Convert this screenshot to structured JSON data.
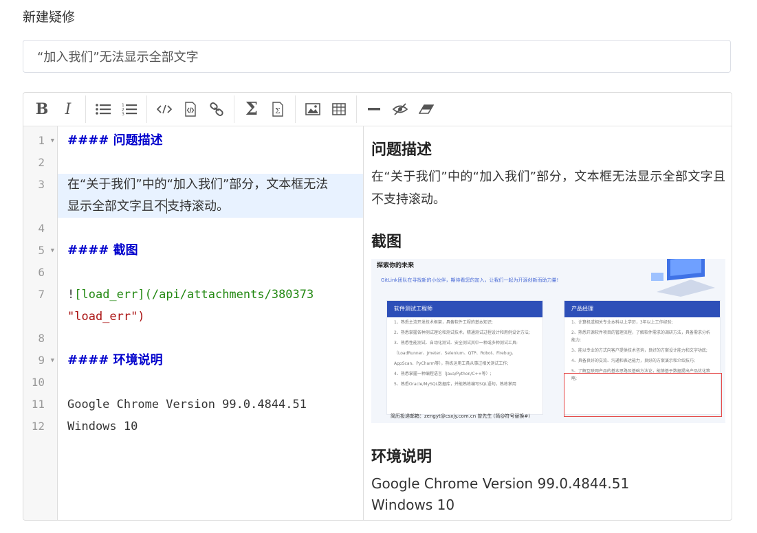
{
  "page": {
    "title": "新建疑修"
  },
  "issue_title": {
    "value": "“加入我们”无法显示全部文字"
  },
  "toolbar": {
    "items": [
      "bold-icon",
      "italic-icon",
      "unordered-list-icon",
      "ordered-list-icon",
      "code-icon",
      "code-block-icon",
      "link-icon",
      "sigma-icon",
      "formula-block-icon",
      "image-icon",
      "table-icon",
      "horizontal-rule-icon",
      "preview-toggle-icon",
      "eraser-icon"
    ],
    "bold_glyph": "B",
    "italic_glyph": "I",
    "sigma_glyph": "Σ"
  },
  "source": {
    "line_numbers": [
      "1",
      "2",
      "3",
      "4",
      "5",
      "6",
      "7",
      "8",
      "9",
      "10",
      "11",
      "12"
    ],
    "lines": {
      "l1": "#### 问题描述",
      "l3a": "在“关于我们”中的“加入我们”部分，文本框无法",
      "l3b_before": "显示全部文字且不",
      "l3b_after": "支持滚动。",
      "l5": "#### 截图",
      "l7_bang": "!",
      "l7_link": "[load_err]",
      "l7_url": "(/api/attachments/380373",
      "l7b": "\"load_err\")",
      "l9": "#### 环境说明",
      "l11": "Google Chrome Version 99.0.4844.51",
      "l12": "Windows 10"
    }
  },
  "preview": {
    "h1": "问题描述",
    "p1": "在“关于我们”中的“加入我们”部分，文本框无法显示全部文字且不支持滚动。",
    "h2": "截图",
    "h3": "环境说明",
    "env_line1": "Google Chrome Version 99.0.4844.51",
    "env_line2": "Windows 10",
    "screenshot": {
      "title": "探索你的未来",
      "subtitle": "GitLink团队在寻找新的小伙伴，期待看您的加入，让我们一起为开源创新而助力量!",
      "card_left_title": "软件测试工程师",
      "card_right_title": "产品经理",
      "card_left_lines": [
        "1、熟悉主流开发技术框架，具备软件工程的基本知识;",
        "2、熟悉掌握各种测试理论和测试技术，精通测试过程设计和用例设计方法;",
        "3、熟悉性能测试、自动化测试、安全测试其中一种或多种测试工具:",
        "（LoadRunner、Jmeter、Selenium、QTP、Robot、Firebug、",
        "AppScan、PyCharm等），熟练运用工具从事过相关测试工作;",
        "4、熟悉掌握一种编程语言（Java/Python/C++等）;",
        "5、熟悉Oracle/MySQL数据库，并能熟练编写SQL语句，熟练掌用"
      ],
      "card_right_lines": [
        "1、计算机或相关专业本科以上学历，3年以上工作经验;",
        "2、熟悉开源软件项目的管理流程，了解软件需求的调研方法，具备需求分析能力;",
        "3、能以专业的方式向客户提供技术咨询，良好的方案设计能力和文字功底;",
        "4、具备良好的交流、沟通和表达能力，良好的方案演示和介绍技巧;",
        "5、了解互联网产品的基本思路及基础方法论，能够基于数据提出产品优化策略;"
      ],
      "footer": "简历投递邮箱：zengyt@csxjy.com.cn 曾先生 (简@符号替换#)"
    }
  },
  "colors": {
    "accent": "#2d4fb8",
    "heading_src": "#0000cc",
    "highlight": "#e8f2ff",
    "redbox": "#e54848"
  }
}
